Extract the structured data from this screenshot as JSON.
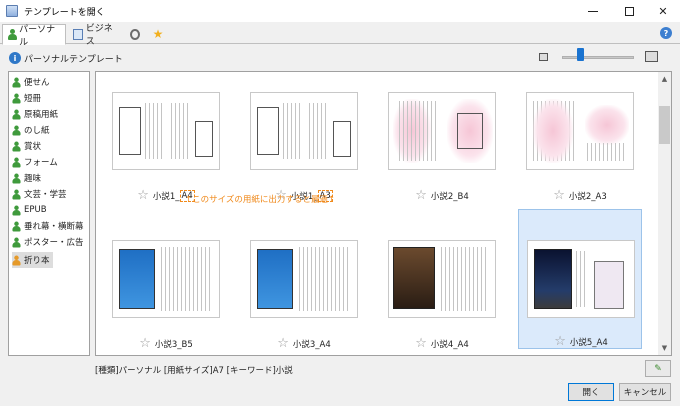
{
  "window": {
    "title": "テンプレートを開く"
  },
  "tabs": [
    {
      "label": "パーソナル"
    },
    {
      "label": "ビジネス"
    }
  ],
  "section": {
    "title": "パーソナルテンプレート"
  },
  "sidebar": {
    "items": [
      {
        "label": "便せん"
      },
      {
        "label": "短冊"
      },
      {
        "label": "原稿用紙"
      },
      {
        "label": "のし紙"
      },
      {
        "label": "賞状"
      },
      {
        "label": "フォーム"
      },
      {
        "label": "趣味"
      },
      {
        "label": "文芸・学芸"
      },
      {
        "label": "EPUB"
      },
      {
        "label": "垂れ幕・横断幕"
      },
      {
        "label": "ポスター・広告"
      },
      {
        "label": "折り本"
      }
    ]
  },
  "templates": [
    {
      "name": "小説1_",
      "size": "A4"
    },
    {
      "name": "小説1_",
      "size": "A3"
    },
    {
      "name": "小説2_B4"
    },
    {
      "name": "小説2_A3"
    },
    {
      "name": "小説3_B5"
    },
    {
      "name": "小説3_A4"
    },
    {
      "name": "小説4_A4"
    },
    {
      "name": "小説5_A4"
    }
  ],
  "note": "↑このサイズの用紙に出力すると最適↑",
  "status": "[種類]パーソナル [用紙サイズ]A7 [キーワード]小説",
  "buttons": {
    "open": "開く",
    "cancel": "キャンセル"
  },
  "colors": {
    "accent": "#1a73d0",
    "highlight": "#f08a1c",
    "selection": "#dbeafb"
  }
}
